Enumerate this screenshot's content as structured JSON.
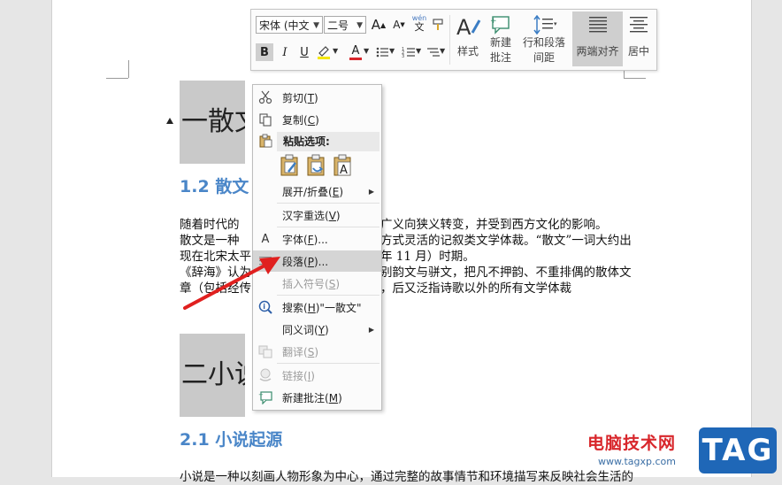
{
  "toolbar": {
    "font_name": "宋体 (中文",
    "font_size": "二号",
    "grow_font": "A",
    "shrink_font": "A",
    "phonetic_top": "wén",
    "phonetic_bottom": "文",
    "bold": "B",
    "italic": "I",
    "underline": "U",
    "font_color": "A",
    "styles_label": "样式",
    "new_comment_line1": "新建",
    "new_comment_line2": "批注",
    "line_para_line1": "行和段落",
    "line_para_line2": "间距",
    "justify_label": "两端对齐",
    "center_label": "居中"
  },
  "document": {
    "heading1_a": "一散文",
    "heading2_a": "1.2 散文",
    "para_lines": [
      "随着时代的",
      "散文是一种",
      "现在北宋太平",
      "《辞海》认为",
      "章（包括经传"
    ],
    "para_right_lines": [
      "广义向狭义转变，并受到西方文化的影响。",
      "方式灵活的记叙类文学体裁。“散文”一词大约出",
      "年 11 月）时期。",
      "别韵文与骈文，把凡不押韵、不重排偶的散体文",
      "，后又泛指诗歌以外的所有文学体裁"
    ],
    "heading1_b": "二小说",
    "heading2_b": "2.1 小说起源",
    "bottom_line": "小说是一种以刻画人物形象为中心，通过完整的故事情节和环境描写来反映社会生活的"
  },
  "context_menu": {
    "cut": "剪切",
    "cut_key": "T",
    "copy": "复制",
    "copy_key": "C",
    "paste_options": "粘贴选项:",
    "expand_collapse": "展开/折叠",
    "expand_collapse_key": "E",
    "reconvert": "汉字重选",
    "reconvert_key": "V",
    "font": "字体",
    "font_key": "F",
    "paragraph": "段落",
    "paragraph_key": "P",
    "insert_symbol": "插入符号",
    "insert_symbol_key": "S",
    "search": "搜索",
    "search_key": "H",
    "search_term": "\"一散文\"",
    "synonyms": "同义词",
    "synonyms_key": "Y",
    "translate": "翻译",
    "translate_key": "S",
    "link": "链接",
    "link_key": "I",
    "new_comment": "新建批注",
    "new_comment_key": "M"
  },
  "watermark": {
    "site_name": "电脑技术网",
    "url": "www.tagxp.com",
    "tag": "TAG"
  },
  "colors": {
    "heading2": "#4a86c8",
    "highlight": "#f4e600",
    "font_red": "#d8262b",
    "arrow_red": "#e0201f",
    "tag_blue": "#1f67b7"
  }
}
